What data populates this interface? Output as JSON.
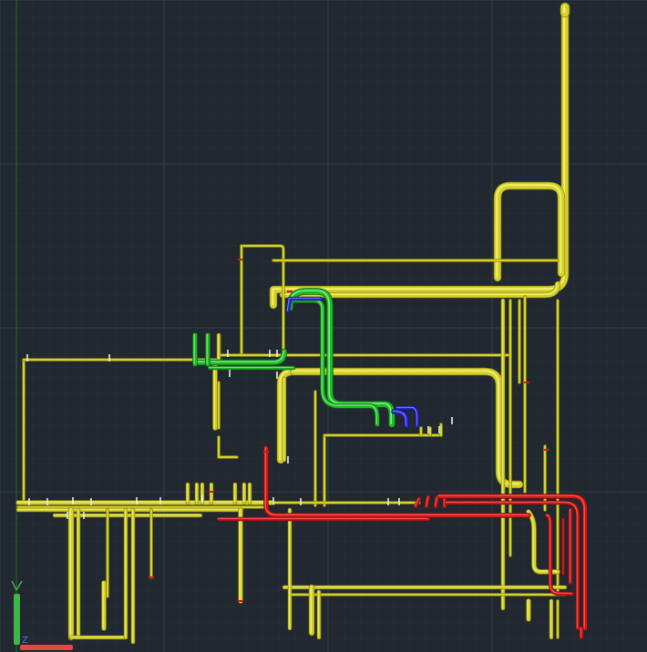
{
  "app": {
    "view_style": "3D piping model in dark CAD viewport"
  },
  "colors": {
    "background": "#212830",
    "grid_minor": "#262d36",
    "grid_major": "#333b46",
    "pipe_yellow": "#d4d12a",
    "pipe_yellow_highlight": "#f2ef72",
    "pipe_yellow_shadow": "#8f8c12",
    "pipe_red": "#d01a1a",
    "pipe_red_highlight": "#ff5a5a",
    "pipe_green": "#22b52a",
    "pipe_green_highlight": "#77f07a",
    "pipe_blue": "#2a2ad6",
    "pipe_blue_highlight": "#7a7aff",
    "marker_white": "#f2f2f2",
    "ucs_y_axis": "#3fb54a",
    "ucs_x_axis": "#e04848",
    "ucs_z_axis": "#4a7ce0"
  },
  "ucs": {
    "y_label": "Y",
    "z_label": "Z"
  },
  "icons": {
    "ucs": "ucs-axis-icon"
  }
}
